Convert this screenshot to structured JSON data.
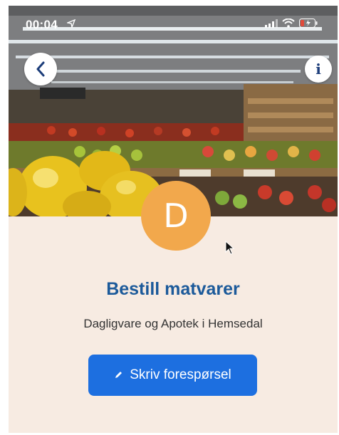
{
  "status_bar": {
    "time": "00:04"
  },
  "header": {
    "back_icon": "chevron-left-icon",
    "info_icon": "info-icon"
  },
  "hero": {
    "description_icon": "grocery-produce-photo"
  },
  "avatar": {
    "letter": "D",
    "color": "#f2a84c"
  },
  "main": {
    "title": "Bestill matvarer",
    "subtitle": "Dagligvare og Apotek i Hemsedal",
    "cta_label": "Skriv forespørsel",
    "cta_color": "#1d6fe0",
    "title_color": "#1c5a9a",
    "background": "#f7ebe2"
  }
}
